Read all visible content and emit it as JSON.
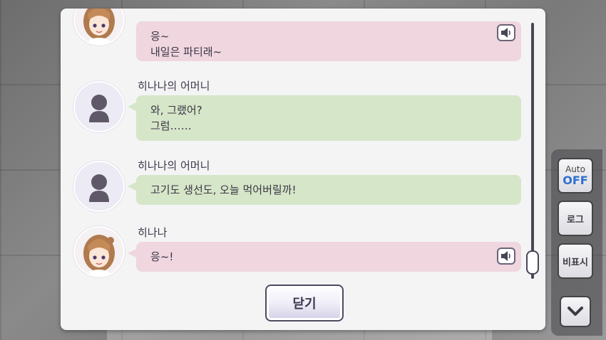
{
  "dialogue_log": {
    "entries": [
      {
        "speaker": "",
        "lines": [
          "응~",
          "내일은 파티래~"
        ],
        "color": "pink",
        "avatar": "hinana-portrait",
        "voice": true
      },
      {
        "speaker": "히나나의 어머니",
        "lines": [
          "와, 그랬어?",
          "그럼……"
        ],
        "color": "green",
        "avatar": "silhouette",
        "voice": false
      },
      {
        "speaker": "히나나의 어머니",
        "lines": [
          "고기도 생선도, 오늘 먹어버릴까!"
        ],
        "color": "green",
        "avatar": "silhouette",
        "voice": false
      },
      {
        "speaker": "히나나",
        "lines": [
          "응~!"
        ],
        "color": "pink",
        "avatar": "hinana-portrait",
        "voice": true
      }
    ],
    "close_label": "닫기"
  },
  "side_menu": {
    "auto_label": "Auto",
    "auto_state": "OFF",
    "log_label": "로그",
    "hide_label": "비표시"
  },
  "colors": {
    "pink_bubble": "#efd6df",
    "green_bubble": "#d6e6c8",
    "auto_off": "#2f6fd0"
  }
}
